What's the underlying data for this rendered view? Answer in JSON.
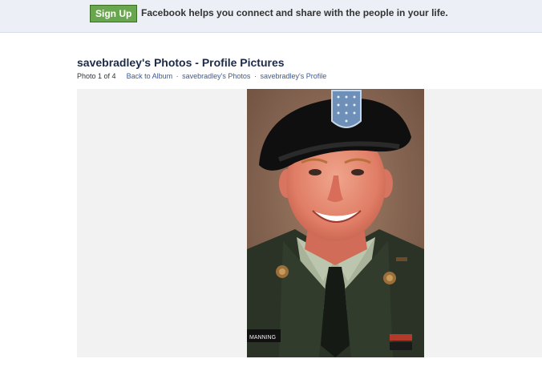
{
  "topbar": {
    "signup_label": "Sign Up",
    "tagline": "Facebook helps you connect and share with the people in your life."
  },
  "album": {
    "title": "savebradley's Photos - Profile Pictures",
    "photo_counter": "Photo 1 of 4",
    "links": {
      "back": "Back to Album",
      "photos": "savebradley's Photos",
      "profile": "savebradley's Profile"
    },
    "separator": "·"
  },
  "photo": {
    "nametag": "MANNING"
  },
  "colors": {
    "link": "#3b5998",
    "signup_green": "#69a74e",
    "topbar_bg": "#eceff5",
    "photo_area_bg": "#f2f2f2"
  }
}
